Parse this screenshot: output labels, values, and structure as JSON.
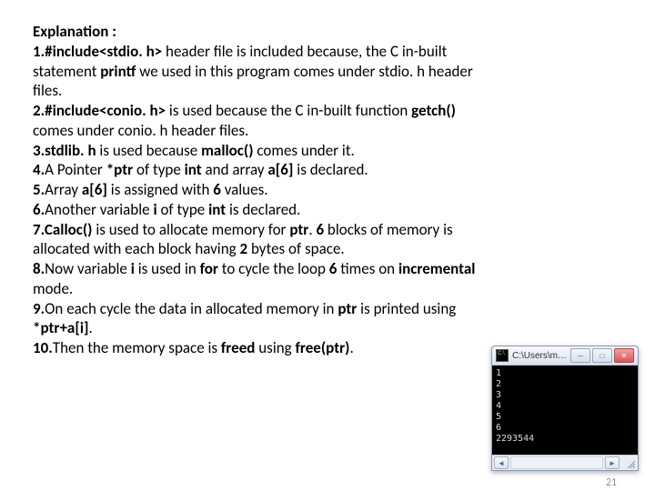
{
  "heading": "Explanation :",
  "lines": [
    [
      {
        "t": "1.",
        "b": true
      },
      {
        "t": "#include<stdio. h> ",
        "b": true
      },
      {
        "t": "header file is included because, the C in-built ",
        "b": false
      }
    ],
    [
      {
        "t": "statement ",
        "b": false
      },
      {
        "t": "printf ",
        "b": true
      },
      {
        "t": "we used in this program comes under stdio. h header ",
        "b": false
      }
    ],
    [
      {
        "t": "files.",
        "b": false
      }
    ],
    [
      {
        "t": "2.",
        "b": true
      },
      {
        "t": "#include<conio. h> ",
        "b": true
      },
      {
        "t": "is used because the C in-built function ",
        "b": false
      },
      {
        "t": "getch() ",
        "b": true
      }
    ],
    [
      {
        "t": "comes under conio. h header files.",
        "b": false
      }
    ],
    [
      {
        "t": "3.",
        "b": true
      },
      {
        "t": "stdlib. h ",
        "b": true
      },
      {
        "t": "is used because ",
        "b": false
      },
      {
        "t": "malloc() ",
        "b": true
      },
      {
        "t": "comes under it.",
        "b": false
      }
    ],
    [
      {
        "t": "4.",
        "b": true
      },
      {
        "t": "A Pointer ",
        "b": false
      },
      {
        "t": "*ptr ",
        "b": true
      },
      {
        "t": "of type ",
        "b": false
      },
      {
        "t": "int ",
        "b": true
      },
      {
        "t": "and array ",
        "b": false
      },
      {
        "t": "a[6] ",
        "b": true
      },
      {
        "t": "is declared.",
        "b": false
      }
    ],
    [
      {
        "t": "5.",
        "b": true
      },
      {
        "t": "Array ",
        "b": false
      },
      {
        "t": "a[6] ",
        "b": true
      },
      {
        "t": "is assigned with ",
        "b": false
      },
      {
        "t": "6 ",
        "b": true
      },
      {
        "t": "values.",
        "b": false
      }
    ],
    [
      {
        "t": "6.",
        "b": true
      },
      {
        "t": "Another variable ",
        "b": false
      },
      {
        "t": "i ",
        "b": true
      },
      {
        "t": "of type ",
        "b": false
      },
      {
        "t": "int ",
        "b": true
      },
      {
        "t": "is declared.",
        "b": false
      }
    ],
    [
      {
        "t": "7.",
        "b": true
      },
      {
        "t": "Calloc() ",
        "b": true
      },
      {
        "t": "is used to allocate memory for ",
        "b": false
      },
      {
        "t": "ptr",
        "b": true
      },
      {
        "t": ". ",
        "b": false
      },
      {
        "t": "6 ",
        "b": true
      },
      {
        "t": "blocks of memory is ",
        "b": false
      }
    ],
    [
      {
        "t": "allocated with each block having ",
        "b": false
      },
      {
        "t": "2 ",
        "b": true
      },
      {
        "t": "bytes of space.",
        "b": false
      }
    ],
    [
      {
        "t": "8.",
        "b": true
      },
      {
        "t": "Now variable ",
        "b": false
      },
      {
        "t": "i ",
        "b": true
      },
      {
        "t": "is used in ",
        "b": false
      },
      {
        "t": "for ",
        "b": true
      },
      {
        "t": "to cycle the loop ",
        "b": false
      },
      {
        "t": "6 ",
        "b": true
      },
      {
        "t": "times on ",
        "b": false
      },
      {
        "t": "incremental ",
        "b": true
      }
    ],
    [
      {
        "t": "mode.",
        "b": false
      }
    ],
    [
      {
        "t": "9.",
        "b": true
      },
      {
        "t": "On each cycle the data in allocated memory in ",
        "b": false
      },
      {
        "t": "ptr ",
        "b": true
      },
      {
        "t": "is printed using ",
        "b": false
      }
    ],
    [
      {
        "t": "*ptr+a[i]",
        "b": true
      },
      {
        "t": ".",
        "b": false
      }
    ],
    [
      {
        "t": "10.",
        "b": true
      },
      {
        "t": "Then the memory space is ",
        "b": false
      },
      {
        "t": "freed ",
        "b": true
      },
      {
        "t": "using ",
        "b": false
      },
      {
        "t": "free(ptr)",
        "b": true
      },
      {
        "t": ".",
        "b": false
      }
    ]
  ],
  "console": {
    "title": "C:\\Users\\ma ...",
    "output": [
      "1",
      "2",
      "3",
      "4",
      "5",
      "6",
      "2293544"
    ]
  },
  "page_number": "21"
}
